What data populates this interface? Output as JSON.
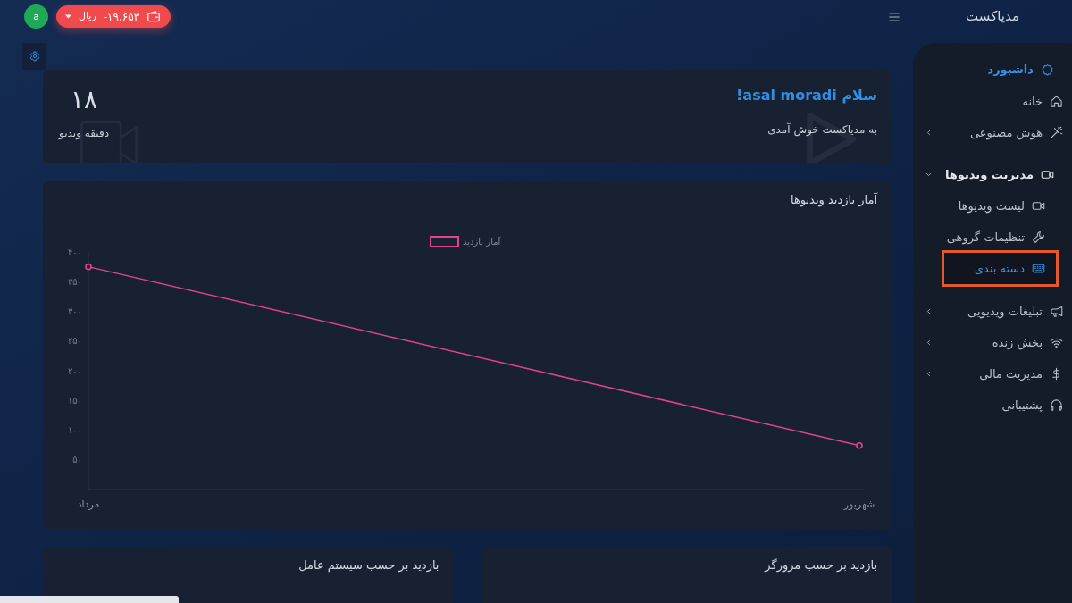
{
  "header": {
    "brand": "مدیاکست",
    "avatar_letter": "a",
    "wallet": {
      "amount": "-۱۹,۶۵۳",
      "currency": "ریال"
    }
  },
  "sidebar": {
    "items": [
      {
        "kind": "heading",
        "label": "داشبورد",
        "selected": true
      },
      {
        "kind": "link",
        "label": "خانه",
        "selected": false
      },
      {
        "kind": "link",
        "label": "هوش مصنوعی",
        "selected": false,
        "expanded": false
      },
      {
        "kind": "link",
        "label": "مدیریت ویدیوها",
        "selected": false,
        "expanded": true,
        "children": [
          {
            "kind": "link",
            "label": "لیست ویدیوها",
            "selected": false,
            "highlighted": false
          },
          {
            "kind": "link",
            "label": "تنظیمات گروهی",
            "selected": false,
            "highlighted": false
          },
          {
            "kind": "link",
            "label": "دسته بندی",
            "selected": true,
            "highlighted": true
          }
        ]
      },
      {
        "kind": "link",
        "label": "تبلیغات ویدیویی",
        "selected": false,
        "expanded": false
      },
      {
        "kind": "link",
        "label": "پخش زنده",
        "selected": false,
        "expanded": false
      },
      {
        "kind": "link",
        "label": "مدیریت مالی",
        "selected": false,
        "expanded": false
      },
      {
        "kind": "link",
        "label": "پشتیبانی",
        "selected": false
      }
    ]
  },
  "welcome": {
    "greeting": "سلام asal moradi!",
    "subtitle": "به مدیاکست خوش آمدی",
    "stat_value": "۱۸",
    "stat_label": "دقیقه ویدیو"
  },
  "views_chart": {
    "chart_data": {
      "type": "line",
      "title": "آمار بازدید ویدیوها",
      "categories": [
        "مرداد",
        "شهریور"
      ],
      "series": [
        {
          "name": "آمار بازدید",
          "color": "#e0428c",
          "marker": "circle",
          "values": [
            375,
            74
          ]
        }
      ],
      "ylim": [
        0,
        400
      ],
      "yticks": [
        {
          "value": 0,
          "label": "۰"
        },
        {
          "value": 50,
          "label": "۵۰"
        },
        {
          "value": 100,
          "label": "۱۰۰"
        },
        {
          "value": 150,
          "label": "۱۵۰"
        },
        {
          "value": 200,
          "label": "۲۰۰"
        },
        {
          "value": 250,
          "label": "۲۵۰"
        },
        {
          "value": 300,
          "label": "۳۰۰"
        },
        {
          "value": 350,
          "label": "۳۵۰"
        },
        {
          "value": 400,
          "label": "۴۰۰"
        }
      ]
    }
  },
  "bottom_cards": [
    {
      "title": "بازدید بر حسب مرورگر"
    },
    {
      "title": "بازدید بر حسب سیستم عامل"
    }
  ]
}
